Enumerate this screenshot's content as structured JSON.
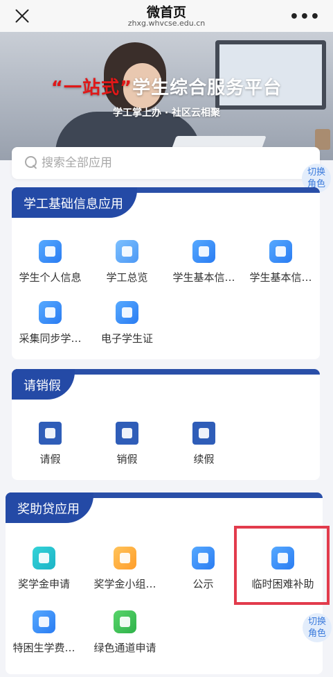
{
  "navbar": {
    "title": "微首页",
    "url": "zhxg.whvcse.edu.cn",
    "more": "•••"
  },
  "banner": {
    "title_quote_open": "“",
    "title_red": "一站式",
    "title_quote_close": "”",
    "title_rest": "学生综合服务平台",
    "subtitle": "学工掌上办 · 社区云相聚"
  },
  "search": {
    "placeholder": "搜索全部应用"
  },
  "switch_role": {
    "line1": "切换",
    "line2": "角色"
  },
  "sections": [
    {
      "title": "学工基础信息应用",
      "apps": [
        {
          "label": "学生个人信息",
          "icon": "student-profile-icon"
        },
        {
          "label": "学工总览",
          "icon": "pie-chart-icon"
        },
        {
          "label": "学生基本信…",
          "icon": "person-icon"
        },
        {
          "label": "学生基本信…",
          "icon": "monitor-icon"
        },
        {
          "label": "采集同步学…",
          "icon": "sync-icon"
        },
        {
          "label": "电子学生证",
          "icon": "id-card-icon"
        }
      ]
    },
    {
      "title": "请销假",
      "apps": [
        {
          "label": "请假",
          "icon": "leave-request-icon"
        },
        {
          "label": "销假",
          "icon": "calendar-30-icon"
        },
        {
          "label": "续假",
          "icon": "extend-leave-icon"
        }
      ]
    },
    {
      "title": "奖助贷应用",
      "apps": [
        {
          "label": "奖学金申请",
          "icon": "scholarship-icon"
        },
        {
          "label": "奖学金小组…",
          "icon": "group-icon"
        },
        {
          "label": "公示",
          "icon": "notice-icon"
        },
        {
          "label": "临时困难补助",
          "icon": "heart-hand-icon"
        },
        {
          "label": "特困生学费…",
          "icon": "tuition-icon"
        },
        {
          "label": "绿色通道申请",
          "icon": "green-channel-icon"
        }
      ]
    }
  ],
  "colors": {
    "brand_blue": "#244aa6",
    "accent_red": "#e01818",
    "highlight_red": "#e23b4c"
  }
}
